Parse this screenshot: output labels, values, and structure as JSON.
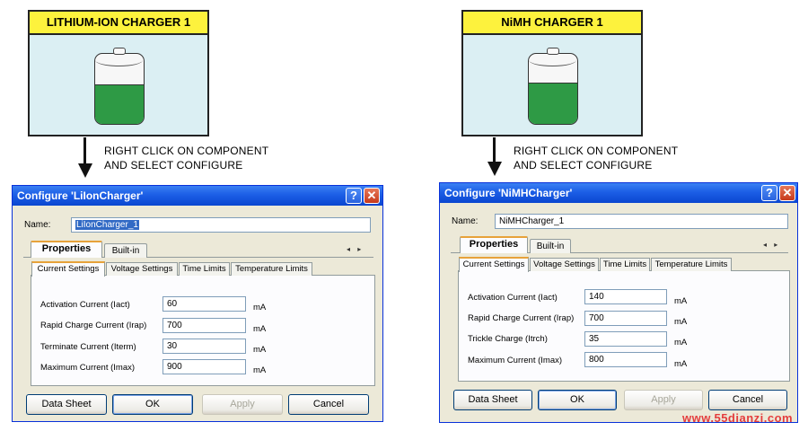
{
  "left": {
    "component": {
      "title": "LITHIUM-ION CHARGER 1"
    },
    "instruction": {
      "line1": "RIGHT CLICK ON COMPONENT",
      "line2": "AND SELECT CONFIGURE"
    },
    "dialog": {
      "title": "Configure 'LiIonCharger'",
      "help_label": "?",
      "close_label": "✕",
      "name_label": "Name:",
      "name_value": "LiIonCharger_1",
      "tabs": [
        "Properties",
        "Built-in"
      ],
      "nav_arrows": "◂ ▸",
      "subtabs": [
        "Current Settings",
        "Voltage Settings",
        "Time Limits",
        "Temperature Limits"
      ],
      "fields": [
        {
          "label": "Activation Current (Iact)",
          "value": "60",
          "unit": "mA"
        },
        {
          "label": "Rapid Charge Current (Irap)",
          "value": "700",
          "unit": "mA"
        },
        {
          "label": "Terminate Current (Iterm)",
          "value": "30",
          "unit": "mA"
        },
        {
          "label": "Maximum Current (Imax)",
          "value": "900",
          "unit": "mA"
        }
      ],
      "buttons": {
        "datasheet": "Data Sheet",
        "ok": "OK",
        "apply": "Apply",
        "cancel": "Cancel"
      }
    }
  },
  "right": {
    "component": {
      "title": "NiMH CHARGER 1"
    },
    "instruction": {
      "line1": "RIGHT CLICK ON COMPONENT",
      "line2": "AND SELECT CONFIGURE"
    },
    "dialog": {
      "title": "Configure 'NiMHCharger'",
      "help_label": "?",
      "close_label": "✕",
      "name_label": "Name:",
      "name_value": "NiMHCharger_1",
      "tabs": [
        "Properties",
        "Built-in"
      ],
      "nav_arrows": "◂ ▸",
      "subtabs": [
        "Current Settings",
        "Voltage Settings",
        "Time Limits",
        "Temperature Limits"
      ],
      "fields": [
        {
          "label": "Activation Current (Iact)",
          "value": "140",
          "unit": "mA"
        },
        {
          "label": "Rapid Charge Current (Irap)",
          "value": "700",
          "unit": "mA"
        },
        {
          "label": "Trickle Charge (Itrch)",
          "value": "35",
          "unit": "mA"
        },
        {
          "label": "Maximum Current (Imax)",
          "value": "800",
          "unit": "mA"
        }
      ],
      "buttons": {
        "datasheet": "Data Sheet",
        "ok": "OK",
        "apply": "Apply",
        "cancel": "Cancel"
      }
    }
  },
  "watermark": "www.55dianzi.com",
  "colors": {
    "title_bar": "#0a46d0",
    "component_title": "#fdf23d",
    "battery_fill": "#2e9a45",
    "tab_highlight": "#e7a23a"
  }
}
